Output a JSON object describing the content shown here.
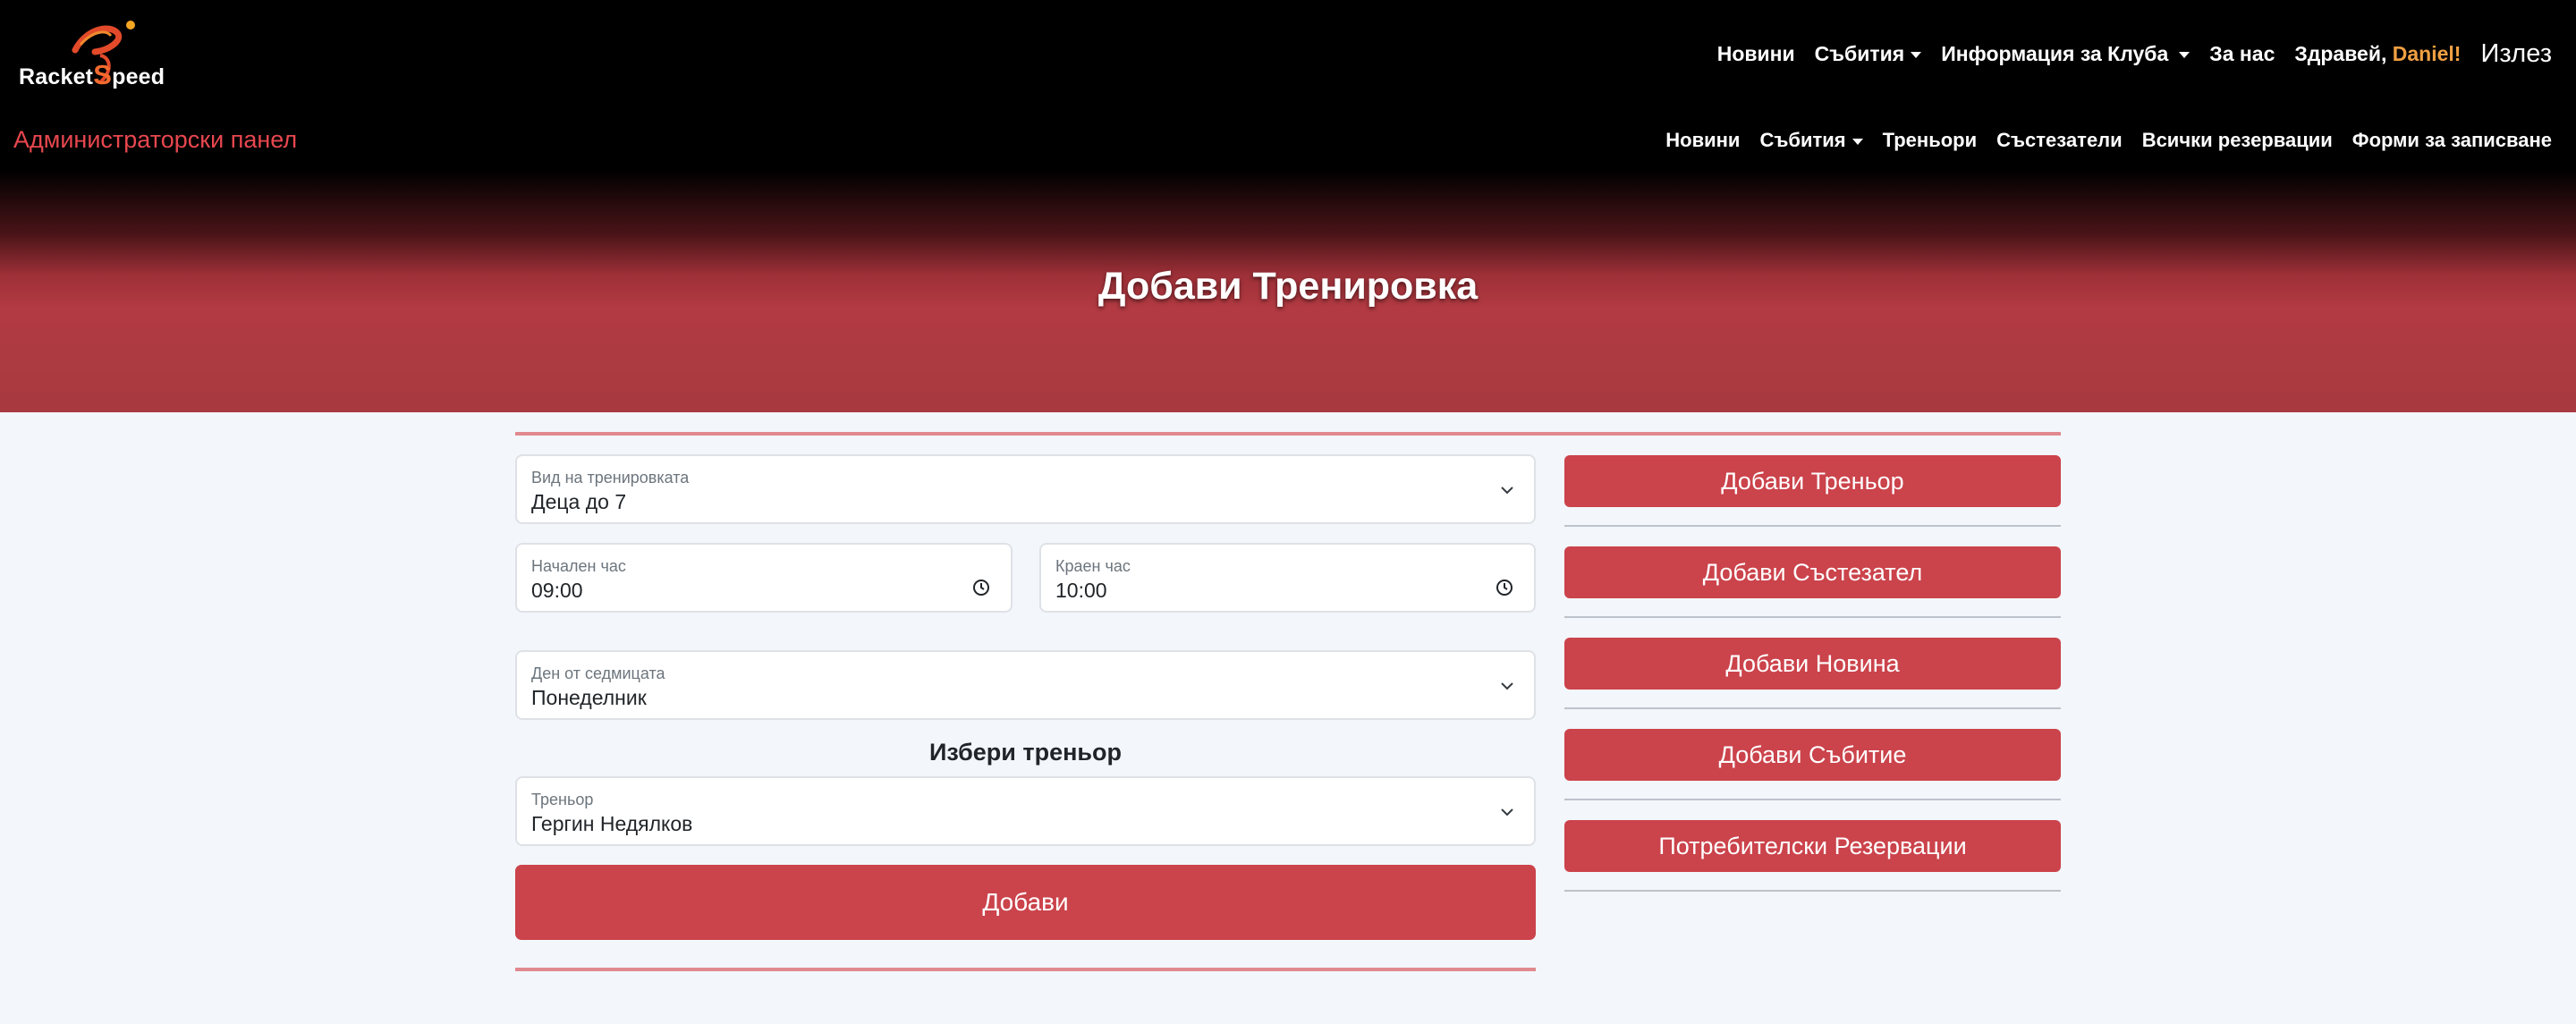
{
  "brand": {
    "logo_text_before": "Racket",
    "logo_text_s": "S",
    "logo_text_after": "peed"
  },
  "topnav": {
    "news": "Новини",
    "events": "Събития",
    "club_info": "Информация за Клуба",
    "about": "За нас",
    "greeting": "Здравей,",
    "username": "Daniel!",
    "logout": "Излез"
  },
  "admin": {
    "title": "Администраторски панел",
    "nav": {
      "news": "Новини",
      "events": "Събития",
      "coaches": "Треньори",
      "competitors": "Състезатели",
      "all_reservations": "Всички резервации",
      "signup_forms": "Форми за записване"
    }
  },
  "page": {
    "title": "Добави Тренировка"
  },
  "form": {
    "training_type": {
      "label": "Вид на тренировката",
      "value": "Деца до 7"
    },
    "start_time": {
      "label": "Начален час",
      "value": "09:00"
    },
    "end_time": {
      "label": "Краен час",
      "value": "10:00"
    },
    "weekday": {
      "label": "Ден от седмицата",
      "value": "Понеделник"
    },
    "choose_coach_heading": "Избери треньор",
    "coach": {
      "label": "Треньор",
      "value": "Гергин Недялков"
    },
    "submit": "Добави"
  },
  "sidebar": {
    "buttons": [
      "Добави Треньор",
      "Добави Състезател",
      "Добави Новина",
      "Добави Събитие",
      "Потребителски Резервации"
    ]
  },
  "colors": {
    "accent": "#cb434b",
    "admin_title": "#e8474f",
    "username": "#f0a042"
  }
}
